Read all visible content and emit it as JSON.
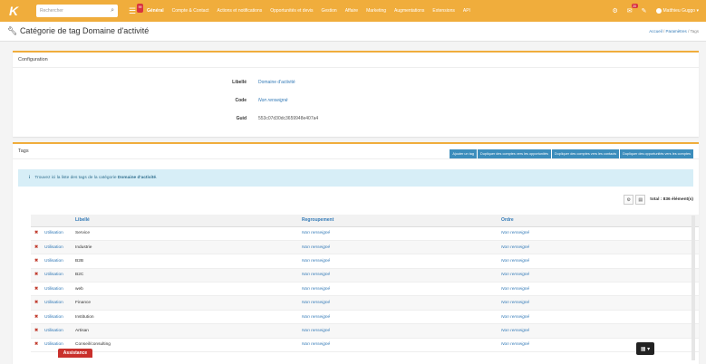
{
  "topbar": {
    "logo": "K",
    "search_placeholder": "Rechercher",
    "search_icon": "search-icon",
    "menu_badge": "99",
    "nav": [
      "Général",
      "Compte & Contact",
      "Actions et notifications",
      "Opportunités et devis",
      "Gestion",
      "Affaire",
      "Marketing",
      "Augmentations",
      "Extensions",
      "API"
    ],
    "right_badge": "20",
    "user_name": "Matthieu Guggo"
  },
  "header": {
    "title": "Catégorie de tag Domaine d'activité",
    "breadcrumb": [
      "Accueil",
      "Paramètres",
      "Tags"
    ]
  },
  "config": {
    "heading": "Configuration",
    "fields": [
      {
        "label": "Libellé",
        "value": "Domaine d'activité"
      },
      {
        "label": "Code",
        "value": "Non renseigné"
      },
      {
        "label": "Guid",
        "value": "553c07d30dc3659948e407a4"
      }
    ]
  },
  "tags": {
    "heading": "Tags",
    "buttons": [
      "Ajouter un tag",
      "Dupliquer des comptes vers les opportunités",
      "Dupliquer des comptes vers les contacts",
      "Dupliquer des opportunités vers les comptes"
    ],
    "info_prefix": "Trouvez ici la liste des tags de la catégorie",
    "info_category": "Domaine d'activité",
    "info_suffix": ".",
    "total": "total : 836 élément(s)",
    "columns": [
      "Libellé",
      "Regroupement",
      "Ordre"
    ],
    "rows": [
      {
        "util": "Utilisation",
        "label": "Service",
        "group": "Non renseigné",
        "order": "Non renseigné"
      },
      {
        "util": "Utilisation",
        "label": "Industrie",
        "group": "Non renseigné",
        "order": "Non renseigné"
      },
      {
        "util": "Utilisation",
        "label": "B2B",
        "group": "Non renseigné",
        "order": "Non renseigné"
      },
      {
        "util": "Utilisation",
        "label": "B2C",
        "group": "Non renseigné",
        "order": "Non renseigné"
      },
      {
        "util": "Utilisation",
        "label": "web",
        "group": "Non renseigné",
        "order": "Non renseigné"
      },
      {
        "util": "Utilisation",
        "label": "Finance",
        "group": "Non renseigné",
        "order": "Non renseigné"
      },
      {
        "util": "Utilisation",
        "label": "Institution",
        "group": "Non renseigné",
        "order": "Non renseigné"
      },
      {
        "util": "Utilisation",
        "label": "Artisan",
        "group": "Non renseigné",
        "order": "Non renseigné"
      },
      {
        "util": "Utilisation",
        "label": "Conseil/consulting",
        "group": "Non renseigné",
        "order": "Non renseigné"
      }
    ]
  },
  "assistance": "Assistance",
  "colors": {
    "accent": "#f0ad3c",
    "link": "#337ab7",
    "button": "#3c8dbc",
    "danger": "#c9302c"
  }
}
